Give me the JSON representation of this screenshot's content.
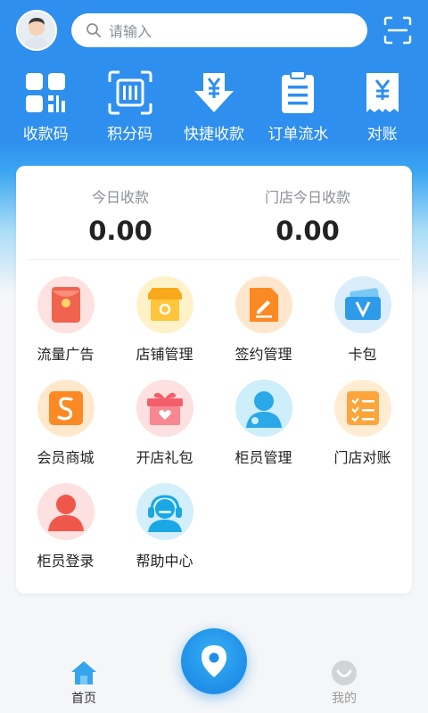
{
  "search": {
    "placeholder": "请输入"
  },
  "quick_actions": [
    {
      "label": "收款码",
      "icon": "qr-grid-icon"
    },
    {
      "label": "积分码",
      "icon": "barcode-scan-icon"
    },
    {
      "label": "快捷收款",
      "icon": "yen-download-icon"
    },
    {
      "label": "订单流水",
      "icon": "order-list-icon"
    },
    {
      "label": "对账",
      "icon": "yen-receipt-icon"
    }
  ],
  "stats": [
    {
      "label": "今日收款",
      "value": "0.00"
    },
    {
      "label": "门店今日收款",
      "value": "0.00"
    }
  ],
  "features": [
    {
      "label": "流量广告",
      "icon": "red-envelope-icon",
      "bg": "#fde2df"
    },
    {
      "label": "店铺管理",
      "icon": "shop-icon",
      "bg": "#fff2c9"
    },
    {
      "label": "签约管理",
      "icon": "sign-document-icon",
      "bg": "#ffe6cc"
    },
    {
      "label": "卡包",
      "icon": "card-wallet-icon",
      "bg": "#d9edfb"
    },
    {
      "label": "会员商城",
      "icon": "member-mall-icon",
      "bg": "#ffe8cc"
    },
    {
      "label": "开店礼包",
      "icon": "gift-box-icon",
      "bg": "#fde0e0"
    },
    {
      "label": "柜员管理",
      "icon": "staff-manage-icon",
      "bg": "#cdeefa"
    },
    {
      "label": "门店对账",
      "icon": "store-reconcile-icon",
      "bg": "#ffecd2"
    },
    {
      "label": "柜员登录",
      "icon": "staff-login-icon",
      "bg": "#fde0e0"
    },
    {
      "label": "帮助中心",
      "icon": "help-center-icon",
      "bg": "#d3effb"
    }
  ],
  "tabs": {
    "home": "首页",
    "mine": "我的"
  },
  "colors": {
    "primary": "#2f8fee",
    "accent": "#1f8ee8"
  }
}
